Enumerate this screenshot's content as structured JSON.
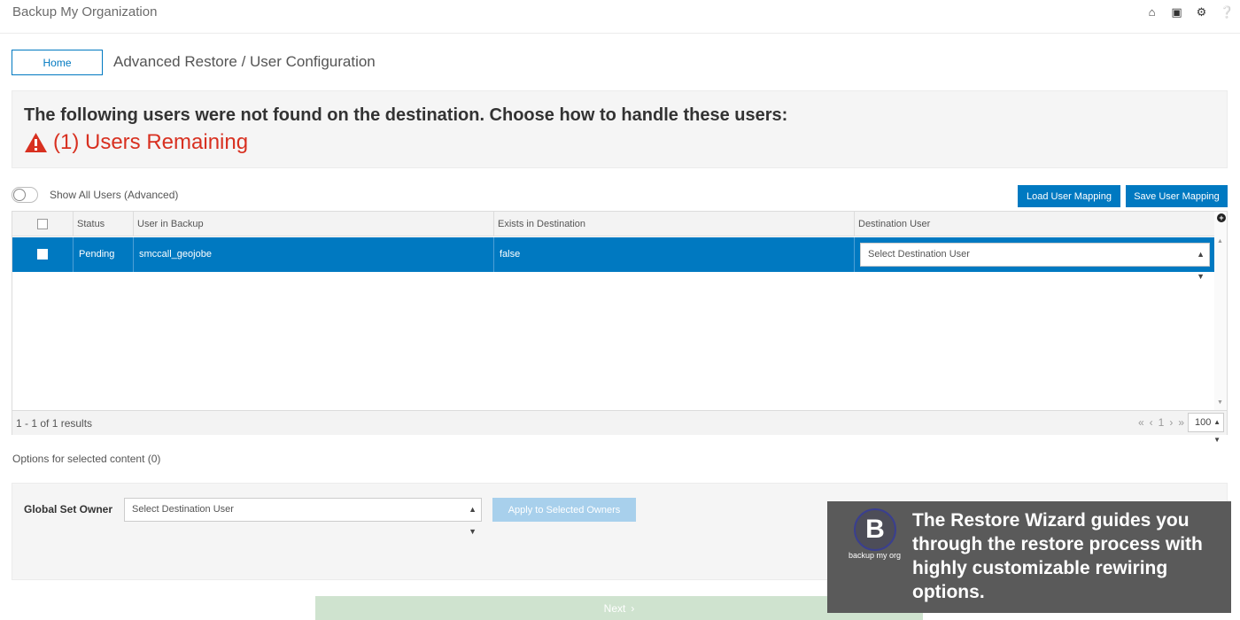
{
  "app": {
    "title": "Backup My Organization"
  },
  "top_icons": [
    "home-icon",
    "id-card-icon",
    "gear-icon",
    "help-icon"
  ],
  "nav": {
    "home_label": "Home",
    "breadcrumb": "Advanced Restore / User Configuration"
  },
  "notice": {
    "heading": "The following users were not found on the destination. Choose how to handle these users:",
    "remaining": "(1) Users Remaining"
  },
  "toggle": {
    "label": "Show All Users (Advanced)",
    "on": false
  },
  "buttons": {
    "load_mapping": "Load User Mapping",
    "save_mapping": "Save User Mapping"
  },
  "grid": {
    "headers": [
      "Status",
      "User in Backup",
      "Exists in Destination",
      "Destination User"
    ],
    "rows": [
      {
        "status": "Pending",
        "user": "smccall_geojobe",
        "exists": "false",
        "destination": "Select Destination User",
        "selected": true
      }
    ],
    "results": "1 - 1 of 1 results",
    "page": "1",
    "page_size": "100"
  },
  "options": {
    "label": "Options for selected content (0)"
  },
  "owner": {
    "label": "Global Set Owner",
    "select": "Select Destination User",
    "apply": "Apply to Selected Owners"
  },
  "next": {
    "label": "Next"
  },
  "promo": {
    "logo_text": "backup my org",
    "text": "The Restore Wizard guides you through the restore process with highly customizable rewiring options."
  },
  "colors": {
    "accent": "#0079c1",
    "warning": "#d83020",
    "next_disabled": "#cfe3cf"
  }
}
